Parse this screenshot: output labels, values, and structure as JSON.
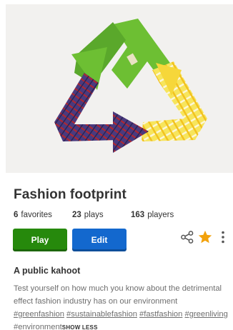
{
  "kahoot": {
    "title": "Fashion footprint",
    "stats": {
      "favorites_count": "6",
      "favorites_label": "favorites",
      "plays_count": "23",
      "plays_label": "plays",
      "players_count": "163",
      "players_label": "players"
    },
    "buttons": {
      "play_label": "Play",
      "edit_label": "Edit"
    },
    "icons": {
      "share": "share-icon",
      "favorite": "star-icon",
      "more": "more-vertical-icon"
    },
    "subtitle": "A public kahoot",
    "description": {
      "text": "Test yourself on how much you know about the detrimental effect fashion industry has on our environment",
      "tags": [
        "#greenfashion",
        "#sustainablefashion",
        "#fastfashion",
        "#greenliving",
        "#environment"
      ],
      "toggle_label": "SHOW LESS"
    }
  },
  "colors": {
    "play": "#26890c",
    "edit": "#1368ce",
    "star": "#f2a20c",
    "title": "#333333",
    "description": "#6e6e6e"
  }
}
